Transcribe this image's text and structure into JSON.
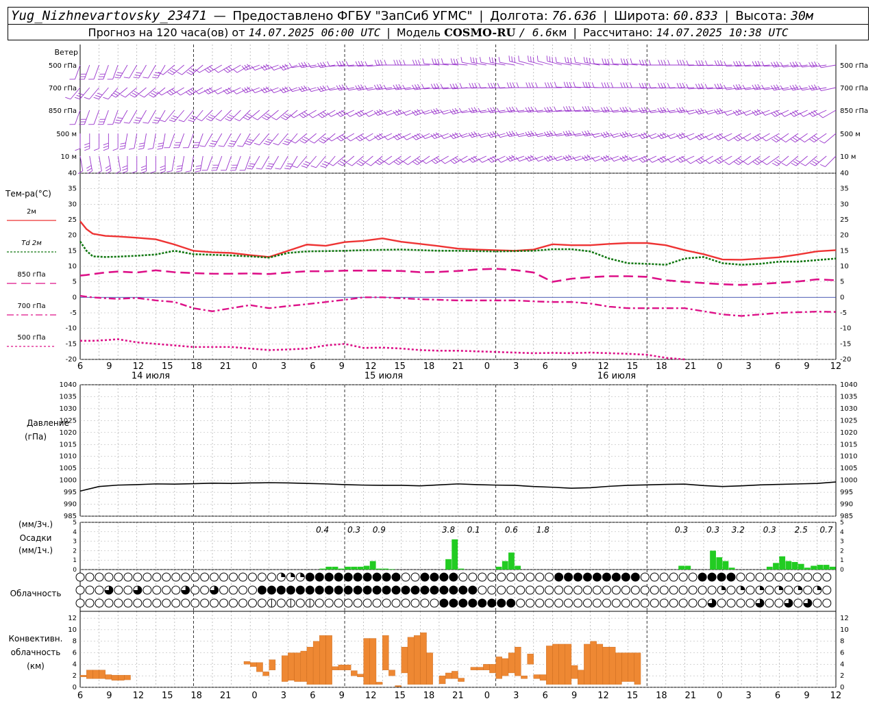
{
  "header": {
    "station": "Yug_Nizhnevartovsky_23471",
    "provider": "Предоставлено ФГБУ \"ЗапСиб УГМС\"",
    "lon_label": "Долгота:",
    "lon_value": "76.636",
    "lat_label": "Широта:",
    "lat_value": "60.833",
    "alt_label": "Высота:",
    "alt_value": "30м",
    "forecast_label": "Прогноз на 120 часа(ов) от",
    "forecast_from": "14.07.2025 06:00 UTC",
    "model_label": "Модель",
    "model_name": "COSMO-RU",
    "model_res": "/ 6.6",
    "model_res_unit": "км",
    "computed_label": "Рассчитано:",
    "computed_value": "14.07.2025 10:38 UTC"
  },
  "wind_panel": {
    "title": "Ветер",
    "levels": [
      "500 гПа",
      "700 гПа",
      "850 гПа",
      "500 м",
      "10 м"
    ],
    "color": "#9933cc"
  },
  "temp_panel": {
    "title": "Тем-ра(°C)",
    "legend": [
      {
        "label": "2м",
        "color": "#ee3333",
        "style": "solid"
      },
      {
        "label": "Td  2м",
        "color": "#117711",
        "style": "dotted"
      },
      {
        "label": "850 гПа",
        "color": "#dd1188",
        "style": "dashed"
      },
      {
        "label": "700 гПа",
        "color": "#dd1188",
        "style": "dashdot"
      },
      {
        "label": "500 гПа",
        "color": "#dd1188",
        "style": "dotted"
      }
    ],
    "yticks": [
      "40",
      "35",
      "30",
      "25",
      "20",
      "15",
      "10",
      "5",
      "0",
      "-5",
      "-10",
      "-15",
      "-20"
    ]
  },
  "time_axis": {
    "hour_labels": [
      "6",
      "9",
      "12",
      "15",
      "18",
      "21",
      "0",
      "3",
      "6",
      "9",
      "12",
      "15",
      "18",
      "21",
      "0",
      "3",
      "6",
      "9",
      "12",
      "15",
      "18",
      "21",
      "0",
      "3",
      "6",
      "9",
      "12"
    ],
    "date_labels": [
      "14 июля",
      "15 июля",
      "16 июля"
    ]
  },
  "pressure_panel": {
    "title": "Давление",
    "unit": "(гПа)",
    "yticks": [
      "1040",
      "1035",
      "1030",
      "1025",
      "1020",
      "1015",
      "1010",
      "1005",
      "1000",
      "995",
      "990",
      "985"
    ]
  },
  "precip_panel": {
    "unit_3h": "(мм/3ч.)",
    "title": "Осадки",
    "unit_1h": "(мм/1ч.)",
    "yticks": [
      "5",
      "4",
      "3",
      "2",
      "1",
      "0"
    ],
    "sums_3h": [
      "0.4",
      "0.3",
      "0.9",
      "3.8",
      "0.1",
      "0.6",
      "1.8",
      "0.3",
      "0.3",
      "3.2",
      "0.3",
      "2.5",
      "0.7"
    ],
    "color": "#22cc22"
  },
  "cloud_panel": {
    "title": "Облачность"
  },
  "conv_panel": {
    "title_1": "Конвективн.",
    "title_2": "облачность",
    "unit": "(км)",
    "yticks": [
      "12",
      "10",
      "8",
      "6",
      "4",
      "2",
      "0"
    ],
    "color": "#ee8833"
  },
  "chart_data": [
    {
      "type": "line",
      "title": "Тем-ра(°C)",
      "x_hours_from_start": [
        0,
        1,
        2,
        4,
        6,
        9,
        12,
        15,
        18,
        21,
        24,
        27,
        30,
        33,
        36,
        39,
        42,
        45,
        48,
        51,
        54,
        57,
        60,
        63,
        66,
        69,
        72,
        75,
        78,
        81,
        84,
        87,
        90,
        93,
        96,
        99,
        102,
        105,
        108,
        111,
        114,
        117,
        120
      ],
      "ylim": [
        -20,
        40
      ],
      "series": [
        {
          "name": "2м",
          "values": [
            24.5,
            22,
            20.5,
            19.8,
            19.6,
            19.2,
            18.7,
            17,
            15,
            14.5,
            14.3,
            13.6,
            13,
            15,
            17,
            16.6,
            17.8,
            18.2,
            19,
            17.9,
            17.2,
            16.5,
            15.7,
            15.4,
            15.2,
            15,
            15.4,
            17.1,
            16.8,
            16.8,
            17.2,
            17.5,
            17.5,
            16.8,
            15.2,
            13.9,
            12.2,
            12.1,
            12.5,
            12.9,
            13.8,
            14.8,
            15.2
          ]
        },
        {
          "name": "Td 2м",
          "values": [
            18,
            15,
            13.2,
            13,
            13.1,
            13.4,
            13.8,
            15,
            13.9,
            13.7,
            13.5,
            13.2,
            12.8,
            14.3,
            14.8,
            14.9,
            15,
            15.2,
            15.3,
            15.4,
            15.2,
            15,
            15,
            14.9,
            14.8,
            14.9,
            15,
            15.5,
            15.5,
            14.8,
            12.5,
            11,
            10.8,
            10.5,
            12.5,
            13,
            11,
            10.5,
            10.8,
            11.5,
            11.5,
            12,
            12.5
          ]
        },
        {
          "name": "850 гПа",
          "values": [
            7,
            7.2,
            7.5,
            8,
            8.3,
            8,
            8.7,
            8.1,
            7.8,
            7.6,
            7.6,
            7.7,
            7.5,
            8,
            8.4,
            8.4,
            8.6,
            8.6,
            8.6,
            8.5,
            8.1,
            8.2,
            8.5,
            9,
            9.2,
            8.8,
            8,
            5,
            6,
            6.5,
            6.8,
            6.8,
            6.6,
            5.5,
            5,
            4.6,
            4.2,
            4,
            4.3,
            4.7,
            5.1,
            5.8,
            5.5
          ]
        },
        {
          "name": "700 гПа",
          "values": [
            0.5,
            0.2,
            0,
            -0.3,
            -0.5,
            -0.2,
            -1,
            -1.5,
            -3.5,
            -4.5,
            -3.5,
            -2.5,
            -3.5,
            -2.8,
            -2.2,
            -1.5,
            -0.8,
            0,
            0,
            -0.3,
            -0.6,
            -0.8,
            -1,
            -1,
            -1,
            -1,
            -1.3,
            -1.5,
            -1.5,
            -2,
            -3,
            -3.5,
            -3.5,
            -3.5,
            -3.5,
            -4.5,
            -5.5,
            -6,
            -5.5,
            -5,
            -4.8,
            -4.6,
            -4.7
          ]
        },
        {
          "name": "500 гПа",
          "values": [
            -14,
            -14,
            -14,
            -13.8,
            -13.5,
            -14.5,
            -15,
            -15.5,
            -16,
            -16,
            -16,
            -16.5,
            -17,
            -16.8,
            -16.5,
            -15.5,
            -15,
            -16.3,
            -16.2,
            -16.5,
            -17,
            -17.2,
            -17.2,
            -17.4,
            -17.6,
            -17.8,
            -18,
            -17.9,
            -18,
            -17.8,
            -18,
            -18.2,
            -18.5,
            -19.5,
            -20
          ]
        }
      ]
    },
    {
      "type": "line",
      "title": "Давление",
      "x_hours_from_start": [
        0,
        3,
        6,
        9,
        12,
        15,
        18,
        21,
        24,
        27,
        30,
        33,
        36,
        39,
        42,
        45,
        48,
        51,
        54,
        57,
        60,
        63,
        66,
        69,
        72,
        75,
        78,
        81,
        84,
        87,
        90,
        93,
        96,
        99,
        102,
        105,
        108,
        111,
        114,
        117,
        120
      ],
      "ylim": [
        985,
        1040
      ],
      "series": [
        {
          "name": "Давление",
          "values": [
            995.5,
            997.4,
            998.0,
            998.2,
            998.5,
            998.4,
            998.6,
            998.8,
            998.7,
            998.9,
            999.0,
            998.9,
            998.7,
            998.5,
            998.2,
            998.0,
            997.9,
            997.9,
            997.7,
            998.1,
            998.5,
            998.2,
            998.0,
            997.9,
            997.4,
            997.1,
            996.7,
            996.9,
            997.5,
            997.9,
            998.1,
            998.3,
            998.4,
            997.8,
            997.4,
            997.7,
            998.1,
            998.3,
            998.5,
            998.7,
            999.3
          ]
        }
      ]
    },
    {
      "type": "bar",
      "title": "Осадки",
      "unit": "мм/1ч.",
      "hours_from_start": [
        39,
        40,
        41,
        42,
        43,
        44,
        45,
        46,
        47,
        48,
        49,
        50,
        59,
        60,
        61,
        67,
        68,
        69,
        70,
        96,
        97,
        101,
        102,
        103,
        104,
        110,
        111,
        112,
        113,
        114,
        115,
        116,
        117,
        118,
        119,
        120
      ],
      "values": [
        0.1,
        0.3,
        0.3,
        0.1,
        0.3,
        0.3,
        0.3,
        0.4,
        0.9,
        0.1,
        0.1,
        0.05,
        1.1,
        3.2,
        0.1,
        0.3,
        0.9,
        1.8,
        0.4,
        0.4,
        0.4,
        2.0,
        1.3,
        0.9,
        0.2,
        0.3,
        0.7,
        1.4,
        0.9,
        0.8,
        0.6,
        0.2,
        0.4,
        0.5,
        0.5,
        0.3
      ]
    },
    {
      "type": "bar",
      "title": "Конвективн. облачность",
      "unit": "км",
      "bars": [
        {
          "h": 1,
          "base": 1.8,
          "top": 2.1
        },
        {
          "h": 2,
          "base": 1.5,
          "top": 3.0
        },
        {
          "h": 3,
          "base": 1.5,
          "top": 3.0
        },
        {
          "h": 4,
          "base": 1.5,
          "top": 3.0
        },
        {
          "h": 5,
          "base": 1.4,
          "top": 2.2
        },
        {
          "h": 6,
          "base": 1.2,
          "top": 2.1
        },
        {
          "h": 7,
          "base": 1.2,
          "top": 2.1
        },
        {
          "h": 8,
          "base": 1.3,
          "top": 2.1
        },
        {
          "h": 27,
          "base": 4.0,
          "top": 4.5
        },
        {
          "h": 28,
          "base": 3.6,
          "top": 4.3
        },
        {
          "h": 29,
          "base": 2.7,
          "top": 4.3
        },
        {
          "h": 30,
          "base": 2.0,
          "top": 2.7
        },
        {
          "h": 31,
          "base": 3.0,
          "top": 4.8
        },
        {
          "h": 33,
          "base": 1.0,
          "top": 5.5
        },
        {
          "h": 34,
          "base": 1.2,
          "top": 6.0
        },
        {
          "h": 35,
          "base": 1.0,
          "top": 6.0
        },
        {
          "h": 36,
          "base": 1.0,
          "top": 6.3
        },
        {
          "h": 37,
          "base": 0.5,
          "top": 7.0
        },
        {
          "h": 38,
          "base": 0.5,
          "top": 8.0
        },
        {
          "h": 39,
          "base": 0.5,
          "top": 9.0
        },
        {
          "h": 40,
          "base": 0.5,
          "top": 9.0
        },
        {
          "h": 41,
          "base": 3.0,
          "top": 3.6
        },
        {
          "h": 42,
          "base": 3.0,
          "top": 3.9
        },
        {
          "h": 43,
          "base": 3.0,
          "top": 3.9
        },
        {
          "h": 44,
          "base": 2.0,
          "top": 2.9
        },
        {
          "h": 45,
          "base": 1.8,
          "top": 2.3
        },
        {
          "h": 46,
          "base": 0.5,
          "top": 8.5
        },
        {
          "h": 47,
          "base": 0.5,
          "top": 8.5
        },
        {
          "h": 48,
          "base": 0.5,
          "top": 0.9
        },
        {
          "h": 49,
          "base": 3.0,
          "top": 9.0
        },
        {
          "h": 50,
          "base": 2.0,
          "top": 3.0
        },
        {
          "h": 51,
          "base": 0.1,
          "top": 0.3
        },
        {
          "h": 52,
          "base": 2.5,
          "top": 7.0
        },
        {
          "h": 53,
          "base": 0.5,
          "top": 8.7
        },
        {
          "h": 54,
          "base": 0.5,
          "top": 9.0
        },
        {
          "h": 55,
          "base": 0.5,
          "top": 9.5
        },
        {
          "h": 56,
          "base": 0.5,
          "top": 6.0
        },
        {
          "h": 58,
          "base": 0.6,
          "top": 2.0
        },
        {
          "h": 59,
          "base": 1.5,
          "top": 2.5
        },
        {
          "h": 60,
          "base": 1.5,
          "top": 2.8
        },
        {
          "h": 61,
          "base": 1.0,
          "top": 1.6
        },
        {
          "h": 63,
          "base": 3.0,
          "top": 3.5
        },
        {
          "h": 64,
          "base": 3.0,
          "top": 3.5
        },
        {
          "h": 65,
          "base": 3.0,
          "top": 4.0
        },
        {
          "h": 66,
          "base": 2.5,
          "top": 4.0
        },
        {
          "h": 67,
          "base": 1.5,
          "top": 5.3
        },
        {
          "h": 68,
          "base": 2.0,
          "top": 5.0
        },
        {
          "h": 69,
          "base": 2.5,
          "top": 6.0
        },
        {
          "h": 70,
          "base": 2.0,
          "top": 7.0
        },
        {
          "h": 71,
          "base": 1.5,
          "top": 2.0
        },
        {
          "h": 72,
          "base": 4.0,
          "top": 5.8
        },
        {
          "h": 73,
          "base": 1.5,
          "top": 2.2
        },
        {
          "h": 74,
          "base": 1.2,
          "top": 2.2
        },
        {
          "h": 75,
          "base": 0.5,
          "top": 7.2
        },
        {
          "h": 76,
          "base": 0.5,
          "top": 7.5
        },
        {
          "h": 77,
          "base": 0.5,
          "top": 7.5
        },
        {
          "h": 78,
          "base": 0.5,
          "top": 7.5
        },
        {
          "h": 79,
          "base": 1.5,
          "top": 3.8
        },
        {
          "h": 80,
          "base": 0.5,
          "top": 3.0
        },
        {
          "h": 81,
          "base": 0.5,
          "top": 7.5
        },
        {
          "h": 82,
          "base": 0.5,
          "top": 8.0
        },
        {
          "h": 83,
          "base": 0.5,
          "top": 7.5
        },
        {
          "h": 84,
          "base": 0.5,
          "top": 7.0
        },
        {
          "h": 85,
          "base": 0.5,
          "top": 7.0
        },
        {
          "h": 86,
          "base": 0.5,
          "top": 6.0
        },
        {
          "h": 87,
          "base": 1.0,
          "top": 6.0
        },
        {
          "h": 88,
          "base": 1.0,
          "top": 6.0
        },
        {
          "h": 89,
          "base": 0.5,
          "top": 6.0
        }
      ]
    }
  ]
}
